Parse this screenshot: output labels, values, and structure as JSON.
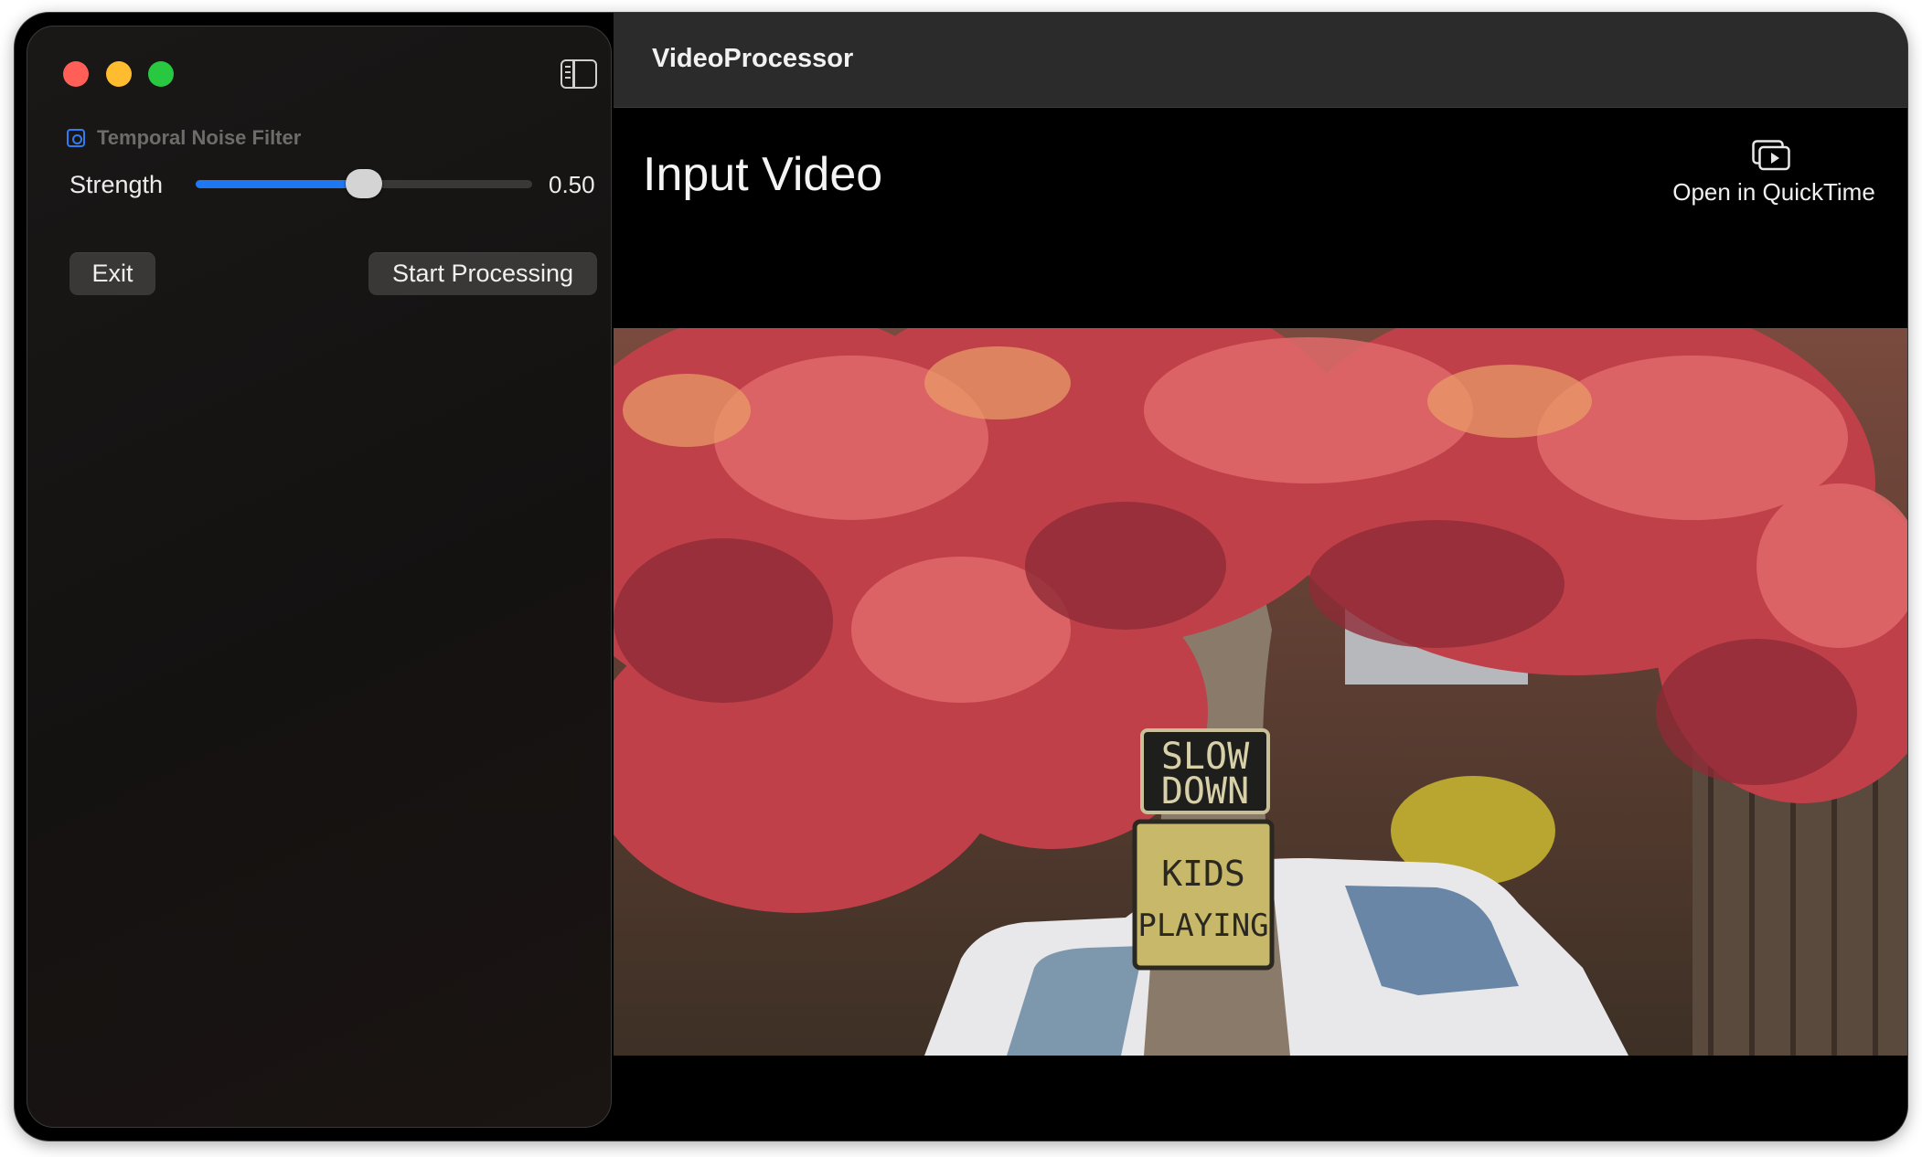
{
  "window": {
    "title": "VideoProcessor"
  },
  "sidebar": {
    "section_title": "Temporal Noise Filter",
    "strength": {
      "label": "Strength",
      "value": 0.5,
      "value_text": "0.50"
    },
    "buttons": {
      "exit": "Exit",
      "start": "Start Processing"
    }
  },
  "main": {
    "heading": "Input Video",
    "open_quicktime": "Open in QuickTime",
    "sign": {
      "line1": "SLOW",
      "line2": "DOWN",
      "line3": "KIDS",
      "line4": "PLAYING"
    }
  },
  "colors": {
    "accent": "#1f78f2",
    "close": "#ff5f57",
    "minimize": "#febc2e",
    "maximize": "#28c840"
  }
}
